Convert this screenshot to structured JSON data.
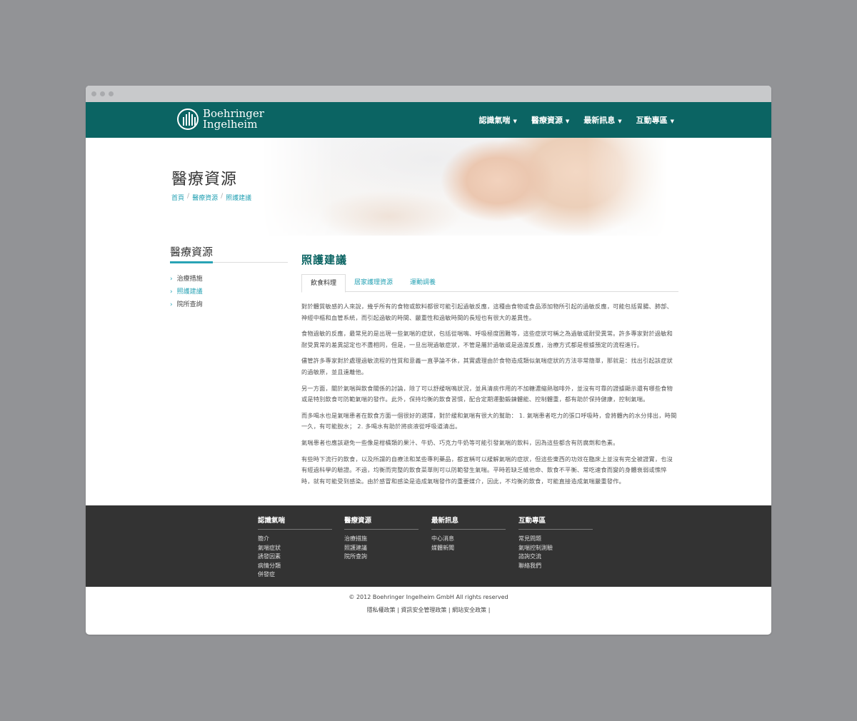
{
  "brand": {
    "name_line1": "Boehringer",
    "name_line2": "Ingelheim"
  },
  "nav": {
    "items": [
      {
        "label": "認識氣喘"
      },
      {
        "label": "醫療資源"
      },
      {
        "label": "最新訊息"
      },
      {
        "label": "互動專區"
      }
    ]
  },
  "hero": {
    "title": "醫療資源",
    "breadcrumb": [
      "首頁",
      "醫療資源",
      "照護建議"
    ]
  },
  "sidebar": {
    "title": "醫療資源",
    "items": [
      {
        "label": "治療措施"
      },
      {
        "label": "照護建議",
        "active": true
      },
      {
        "label": "院所查詢"
      }
    ]
  },
  "main": {
    "title": "照護建議",
    "tabs": [
      {
        "label": "飲食料理",
        "active": true
      },
      {
        "label": "居家護理資源"
      },
      {
        "label": "運動調養"
      }
    ],
    "paragraphs": [
      "對於體質敏感的人來說，幾乎所有的食物或飲料都很可能引起過敏反應，這種由食物或食品添加物所引起的過敏反應，可能包括胃腸、肺部、神經中樞和血管系統，而引起過敏的時間、嚴重性和過敏時間的長短也有很大的差異性。",
      "食物過敏的反應，最常見的是出現一些氣喘的症狀，包括從喘鳴、呼吸極度困難等，這些症狀可稱之為過敏或耐受異常。許多專家對於過敏和耐受異常的差異認定也不盡相同，但是，一旦出現過敏症狀，不管是屬於過敏或是過渡反應，治療方式都是根據預定的流程進行。",
      "儘管許多專家對於處理過敏流程的性質和意義一直爭論不休，其實處理由於食物造成類似氣喘症狀的方法非常簡單，那就是：找出引起該症狀的過敏原，並且遠離他。",
      "另一方面，關於氣喘與飲食關係的討論，除了可以舒緩喘鳴狀況，並具清痰作用的不加糖濃縮熱咖啡外，並沒有可靠的證據顯示還有哪些食物或是特別飲食可防範氣喘的發作。此外，保持均衡的飲食習慣，配合定期運動鍛鍊體能、控制體重，都有助於保持健康，控制氣喘。",
      "而多喝水也是氣喘患者在飲食方面一個很好的選擇，對於緩和氣喘有很大的幫助： 1. 氣喘患者吃力的張口呼吸時，會將體內的水分排出，時間一久，有可能脫水； 2. 多喝水有助於將痰液從呼吸道清出。",
      "氣喘患者也應該避免一些像是柑橘類的果汁、牛奶、巧克力牛奶等可能引發氣喘的飲料，因為這些都含有防腐劑和色素。",
      "有些時下流行的飲食，以及所謂的自療法和某些專利藥品，都宣稱可以緩解氣喘的症狀，但這些東西的功效在臨床上並沒有完全被證實，也沒有經過科學的驗證。不過，均衡而完整的飲食菜單則可以防範發生氣喘。平時若缺乏維他命、飲食不平衡、常吃速食而變的身體衰弱或憔悴時，就有可能受到感染。由於感冒和感染是造成氣喘發作的重要媒介，因此，不均衡的飲食，可能直接造成氣喘嚴重發作。"
    ]
  },
  "footer": {
    "columns": [
      {
        "title": "認識氣喘",
        "items": [
          "簡介",
          "氣喘症狀",
          "誘發因素",
          "病情分類",
          "併發症"
        ]
      },
      {
        "title": "醫療資源",
        "items": [
          "治療措施",
          "照護建議",
          "院所查詢"
        ]
      },
      {
        "title": "最新訊息",
        "items": [
          "中心消息",
          "媒體新聞"
        ]
      },
      {
        "title": "互動專區",
        "items": [
          "常見問題",
          "氣喘控制測驗",
          "諮詢交流",
          "聯絡我們"
        ]
      }
    ],
    "copyright": "© 2012 Boehringer Ingelheim GmbH All rights reserved",
    "policies": [
      "隱私權政策",
      "資訊安全管理政策",
      "網站安全政策"
    ]
  },
  "colors": {
    "header_bg": "#0b6463",
    "accent": "#29a3b5",
    "footer_bg": "#333333",
    "page_bg": "#929396"
  }
}
